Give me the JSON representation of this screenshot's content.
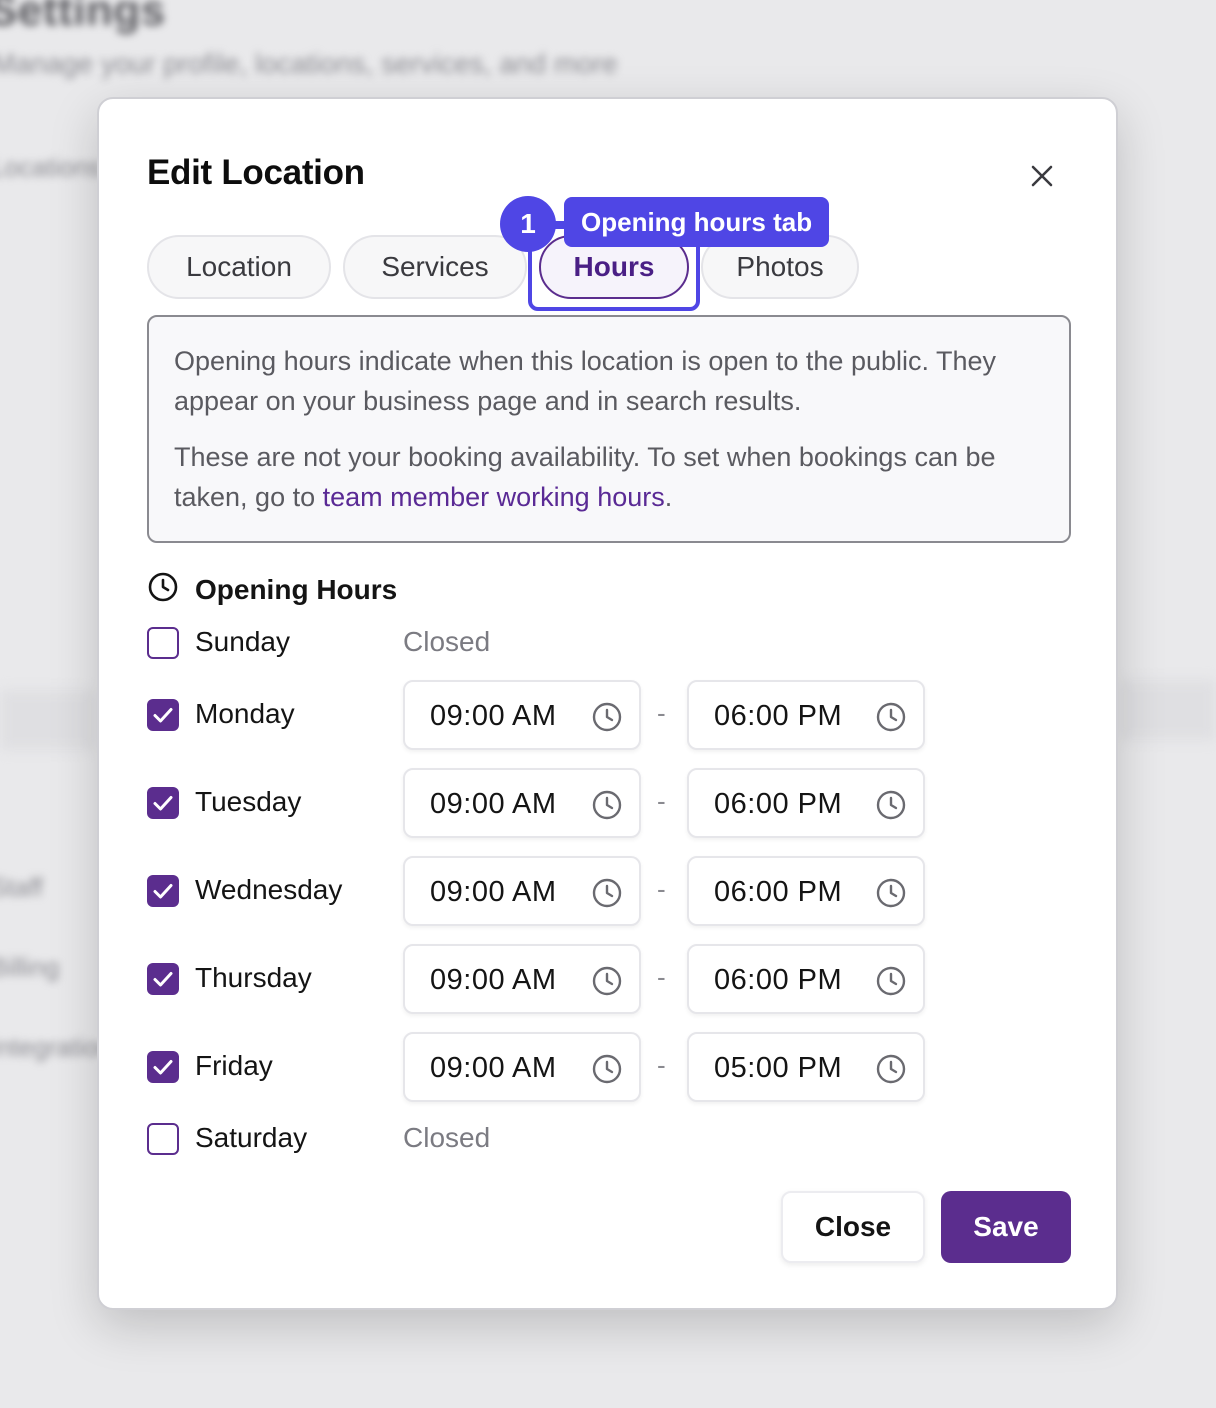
{
  "background": {
    "title": "Settings",
    "subtitle": "Manage your profile, locations, services, and more",
    "side_items": [
      "Locations",
      "Staff",
      "Billing",
      "Integrations"
    ]
  },
  "modal": {
    "title": "Edit Location",
    "close_icon": "close-icon"
  },
  "tabs": [
    {
      "label": "Location",
      "active": false
    },
    {
      "label": "Services",
      "active": false
    },
    {
      "label": "Hours",
      "active": true
    },
    {
      "label": "Photos",
      "active": false
    }
  ],
  "annotation": {
    "number": "1",
    "label": "Opening hours tab",
    "color": "#4f46e5"
  },
  "info": {
    "paragraph1": "Opening hours indicate when this location is open to the public. They appear on your business page and in search results.",
    "paragraph2_prefix": "These are not your booking availability. To set when bookings can be taken, go to ",
    "link_text": "team member working hours",
    "paragraph2_suffix": "."
  },
  "opening_hours": {
    "section_title": "Opening Hours",
    "section_icon": "clock-icon",
    "closed_label": "Closed",
    "separator": "-",
    "days": [
      {
        "day": "Sunday",
        "open": false
      },
      {
        "day": "Monday",
        "open": true,
        "from": "09:00 AM",
        "to": "06:00 PM"
      },
      {
        "day": "Tuesday",
        "open": true,
        "from": "09:00 AM",
        "to": "06:00 PM"
      },
      {
        "day": "Wednesday",
        "open": true,
        "from": "09:00 AM",
        "to": "06:00 PM"
      },
      {
        "day": "Thursday",
        "open": true,
        "from": "09:00 AM",
        "to": "06:00 PM"
      },
      {
        "day": "Friday",
        "open": true,
        "from": "09:00 AM",
        "to": "05:00 PM"
      },
      {
        "day": "Saturday",
        "open": false
      }
    ]
  },
  "footer": {
    "close_label": "Close",
    "save_label": "Save"
  },
  "colors": {
    "brand": "#5b2d8e",
    "annotation": "#4f46e5"
  }
}
